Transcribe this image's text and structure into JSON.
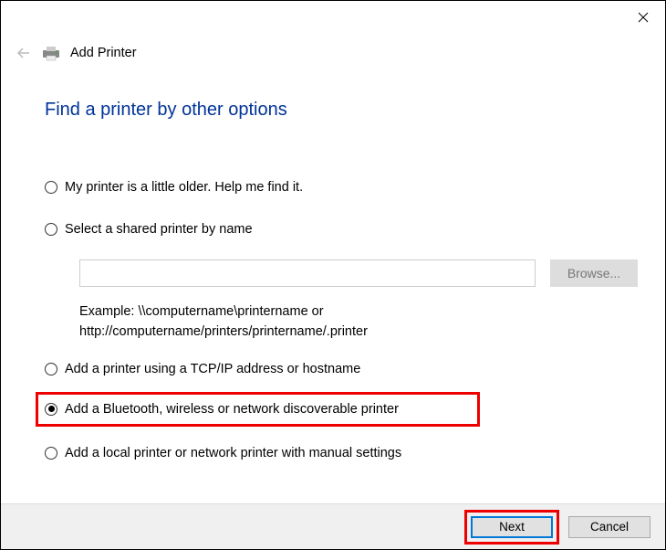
{
  "header": {
    "title": "Add Printer"
  },
  "heading": "Find a printer by other options",
  "options": {
    "older": "My printer is a little older. Help me find it.",
    "shared": "Select a shared printer by name",
    "tcpip": "Add a printer using a TCP/IP address or hostname",
    "bluetooth": "Add a Bluetooth, wireless or network discoverable printer",
    "local": "Add a local printer or network printer with manual settings"
  },
  "shared_section": {
    "input_value": "",
    "browse_label": "Browse...",
    "example_line1": "Example: \\\\computername\\printername or",
    "example_line2": "http://computername/printers/printername/.printer"
  },
  "footer": {
    "next": "Next",
    "cancel": "Cancel"
  },
  "selected_option": "bluetooth"
}
